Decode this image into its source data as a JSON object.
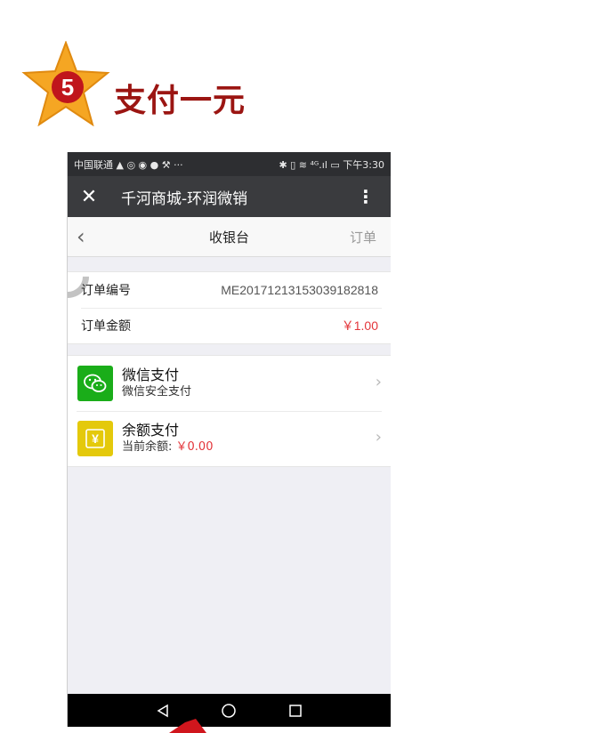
{
  "step": {
    "number": "5",
    "title": "支付一元"
  },
  "status_bar": {
    "carrier": "中国联通",
    "time": "下午3:30"
  },
  "top_bar": {
    "title": "千河商城-环润微销"
  },
  "nav": {
    "title": "收银台",
    "right_link": "订单"
  },
  "order": {
    "number_label": "订单编号",
    "number_value": "ME20171213153039182818",
    "amount_label": "订单金额",
    "amount_value": "￥1.00"
  },
  "payments": [
    {
      "title": "微信支付",
      "subtitle": "微信安全支付",
      "icon": "wechat-icon"
    },
    {
      "title": "余额支付",
      "subtitle_label": "当前余额: ",
      "subtitle_value": "￥0.00",
      "icon": "yen-icon"
    }
  ],
  "colors": {
    "accent_red": "#e3353a",
    "wechat_green": "#1aad19",
    "balance_yellow": "#e4c90b",
    "title_red": "#9b1512"
  }
}
